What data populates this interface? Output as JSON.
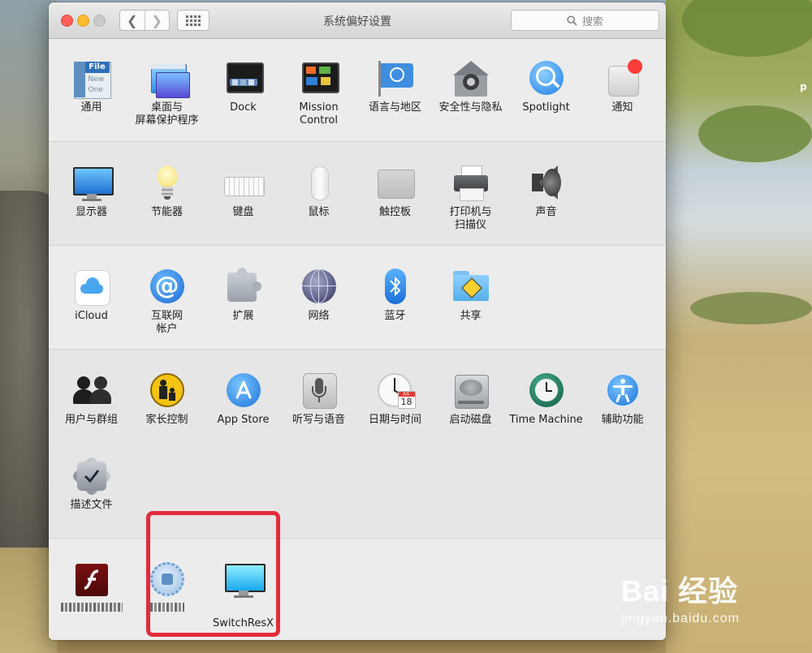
{
  "window": {
    "title": "系统偏好设置"
  },
  "search": {
    "placeholder": "搜索"
  },
  "sections": {
    "personal": [
      {
        "label": "通用"
      },
      {
        "label": "桌面与\n屏幕保护程序"
      },
      {
        "label": "Dock"
      },
      {
        "label": "Mission\nControl"
      },
      {
        "label": "语言与地区"
      },
      {
        "label": "安全性与隐私"
      },
      {
        "label": "Spotlight"
      },
      {
        "label": "通知"
      }
    ],
    "hardware": [
      {
        "label": "显示器"
      },
      {
        "label": "节能器"
      },
      {
        "label": "键盘"
      },
      {
        "label": "鼠标"
      },
      {
        "label": "触控板"
      },
      {
        "label": "打印机与\n扫描仪"
      },
      {
        "label": "声音"
      }
    ],
    "internet": [
      {
        "label": "iCloud"
      },
      {
        "label": "互联网\n帐户"
      },
      {
        "label": "扩展"
      },
      {
        "label": "网络"
      },
      {
        "label": "蓝牙"
      },
      {
        "label": "共享"
      }
    ],
    "system": [
      {
        "label": "用户与群组"
      },
      {
        "label": "家长控制"
      },
      {
        "label": "App Store"
      },
      {
        "label": "听写与语音"
      },
      {
        "label": "日期与时间"
      },
      {
        "label": "启动磁盘"
      },
      {
        "label": "Time Machine"
      },
      {
        "label": "辅助功能"
      },
      {
        "label": "描述文件"
      }
    ],
    "other": [
      {
        "label": ""
      },
      {
        "label": ""
      },
      {
        "label": "SwitchResX"
      }
    ]
  },
  "icons": {
    "general_file": "File",
    "general_new": "New",
    "general_one": "One",
    "calendar_month": "JUL",
    "calendar_day": "18"
  },
  "desktop": {
    "fragment": "p"
  },
  "watermark": {
    "logo": "Bai 经验",
    "url": "jingyan.baidu.com"
  },
  "colors": {
    "highlight": "#e32b3c",
    "notification_badge": "#fc3d39"
  }
}
